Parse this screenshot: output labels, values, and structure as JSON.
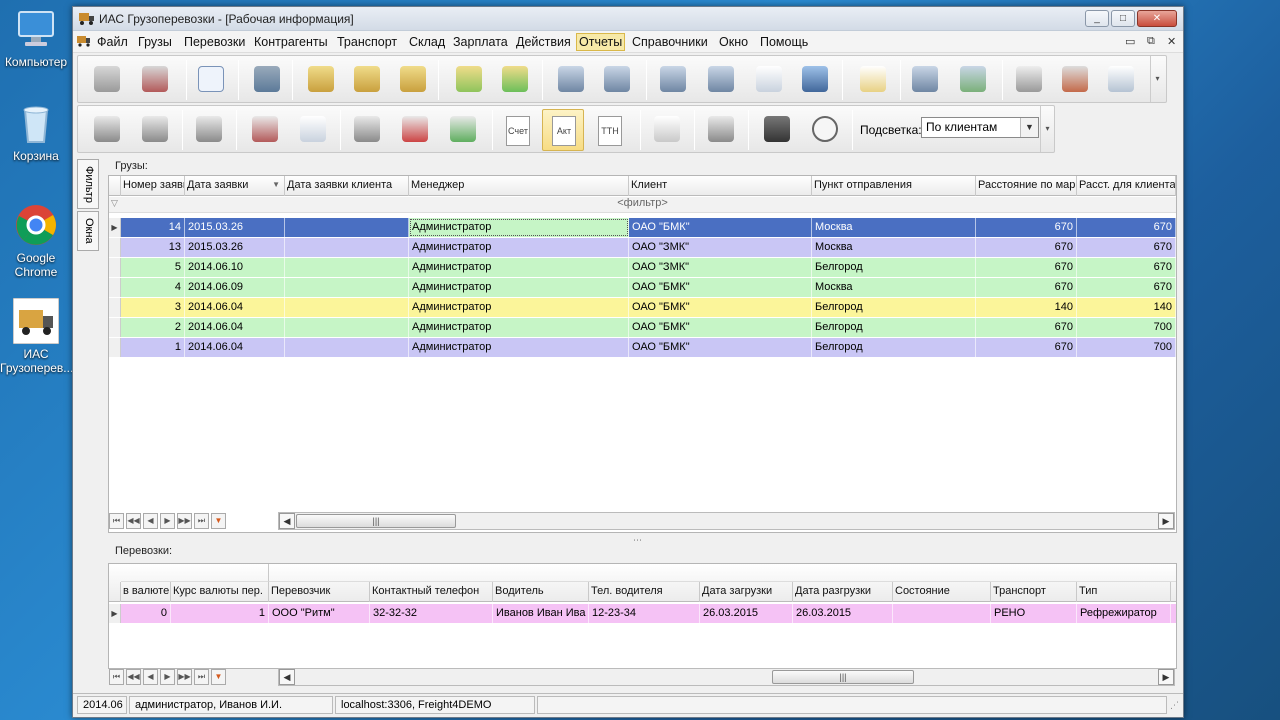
{
  "desktop": [
    {
      "label": "Компьютер",
      "icon": "computer-icon"
    },
    {
      "label": "Корзина",
      "icon": "recycle-bin-icon"
    },
    {
      "label": "Google Chrome",
      "icon": "chrome-icon"
    },
    {
      "label": "ИАС Грузоперев...",
      "icon": "truck-icon"
    }
  ],
  "window": {
    "title": "ИАС Грузоперевозки - [Рабочая информация]",
    "controls": [
      "_",
      "□",
      "✕"
    ]
  },
  "menu": {
    "items": [
      "Файл",
      "Грузы",
      "Перевозки",
      "Контрагенты",
      "Транспорт",
      "Склад",
      "Зарплата",
      "Действия",
      "Отчеты",
      "Справочники",
      "Окно",
      "Помощь"
    ],
    "active": "Отчеты",
    "mdi": [
      "▭",
      "⧉",
      "✕"
    ]
  },
  "toolbar2": {
    "docs": [
      "Счет",
      "Акт",
      "ТТН"
    ],
    "highlight_label": "Подсветка:",
    "highlight_value": "По клиентам"
  },
  "sidetabs": [
    "Фильтр",
    "Окна"
  ],
  "cargo": {
    "label": "Грузы:",
    "filter_text": "<фильтр>",
    "columns": [
      "Номер заявки",
      "Дата заявки",
      "Дата заявки клиента",
      "Менеджер",
      "Клиент",
      "Пункт отправления",
      "Расстояние по маршруту",
      "Расст. для клиента"
    ],
    "rows": [
      {
        "num": "14",
        "date": "2015.03.26",
        "client_date": "",
        "manager": "Администратор",
        "client": "ОАО \"БМК\"",
        "from": "Москва",
        "dist": "670",
        "dist_client": "670",
        "color": "#4a6fc2",
        "text": "#ffffff"
      },
      {
        "num": "13",
        "date": "2015.03.26",
        "client_date": "",
        "manager": "Администратор",
        "client": "ОАО \"ЗМК\"",
        "from": "Москва",
        "dist": "670",
        "dist_client": "670",
        "color": "#c9c6f5",
        "text": "#000000"
      },
      {
        "num": "5",
        "date": "2014.06.10",
        "client_date": "",
        "manager": "Администратор",
        "client": "ОАО \"ЗМК\"",
        "from": "Белгород",
        "dist": "670",
        "dist_client": "670",
        "color": "#c6f5c6",
        "text": "#000000"
      },
      {
        "num": "4",
        "date": "2014.06.09",
        "client_date": "",
        "manager": "Администратор",
        "client": "ОАО \"БМК\"",
        "from": "Москва",
        "dist": "670",
        "dist_client": "670",
        "color": "#c6f5c6",
        "text": "#000000"
      },
      {
        "num": "3",
        "date": "2014.06.04",
        "client_date": "",
        "manager": "Администратор",
        "client": "ОАО \"БМК\"",
        "from": "Белгород",
        "dist": "140",
        "dist_client": "140",
        "color": "#fbf59a",
        "text": "#000000"
      },
      {
        "num": "2",
        "date": "2014.06.04",
        "client_date": "",
        "manager": "Администратор",
        "client": "ОАО \"БМК\"",
        "from": "Белгород",
        "dist": "670",
        "dist_client": "700",
        "color": "#c6f5c6",
        "text": "#000000"
      },
      {
        "num": "1",
        "date": "2014.06.04",
        "client_date": "",
        "manager": "Администратор",
        "client": "ОАО \"БМК\"",
        "from": "Белгород",
        "dist": "670",
        "dist_client": "700",
        "color": "#c9c6f5",
        "text": "#000000"
      }
    ],
    "selected_manager_color": "#c6f5c6"
  },
  "transport": {
    "label": "Перевозки:",
    "columns": [
      "в валюте",
      "Курс валюты пер.",
      "Перевозчик",
      "Контактный телефон",
      "Водитель",
      "Тел. водителя",
      "Дата загрузки",
      "Дата разгрузки",
      "Состояние",
      "Транспорт",
      "Тип"
    ],
    "rows": [
      {
        "cur": "0",
        "rate": "1",
        "carrier": "ООО \"Ритм\"",
        "phone": "32-32-32",
        "driver": "Иванов Иван Ива",
        "driver_phone": "12-23-34",
        "load": "26.03.2015",
        "unload": "26.03.2015",
        "state": "",
        "vehicle": "РЕНО",
        "type": "Рефрежиратор",
        "color": "#f5c2f5"
      }
    ]
  },
  "nav": {
    "first": "⏮",
    "prev_page": "◀◀",
    "prev": "◀",
    "next": "▶",
    "next_page": "▶▶",
    "last": "⏭",
    "filter": "▼"
  },
  "status": [
    "2014.06",
    "администратор, Иванов И.И.",
    "localhost:3306, Freight4DEMO"
  ]
}
